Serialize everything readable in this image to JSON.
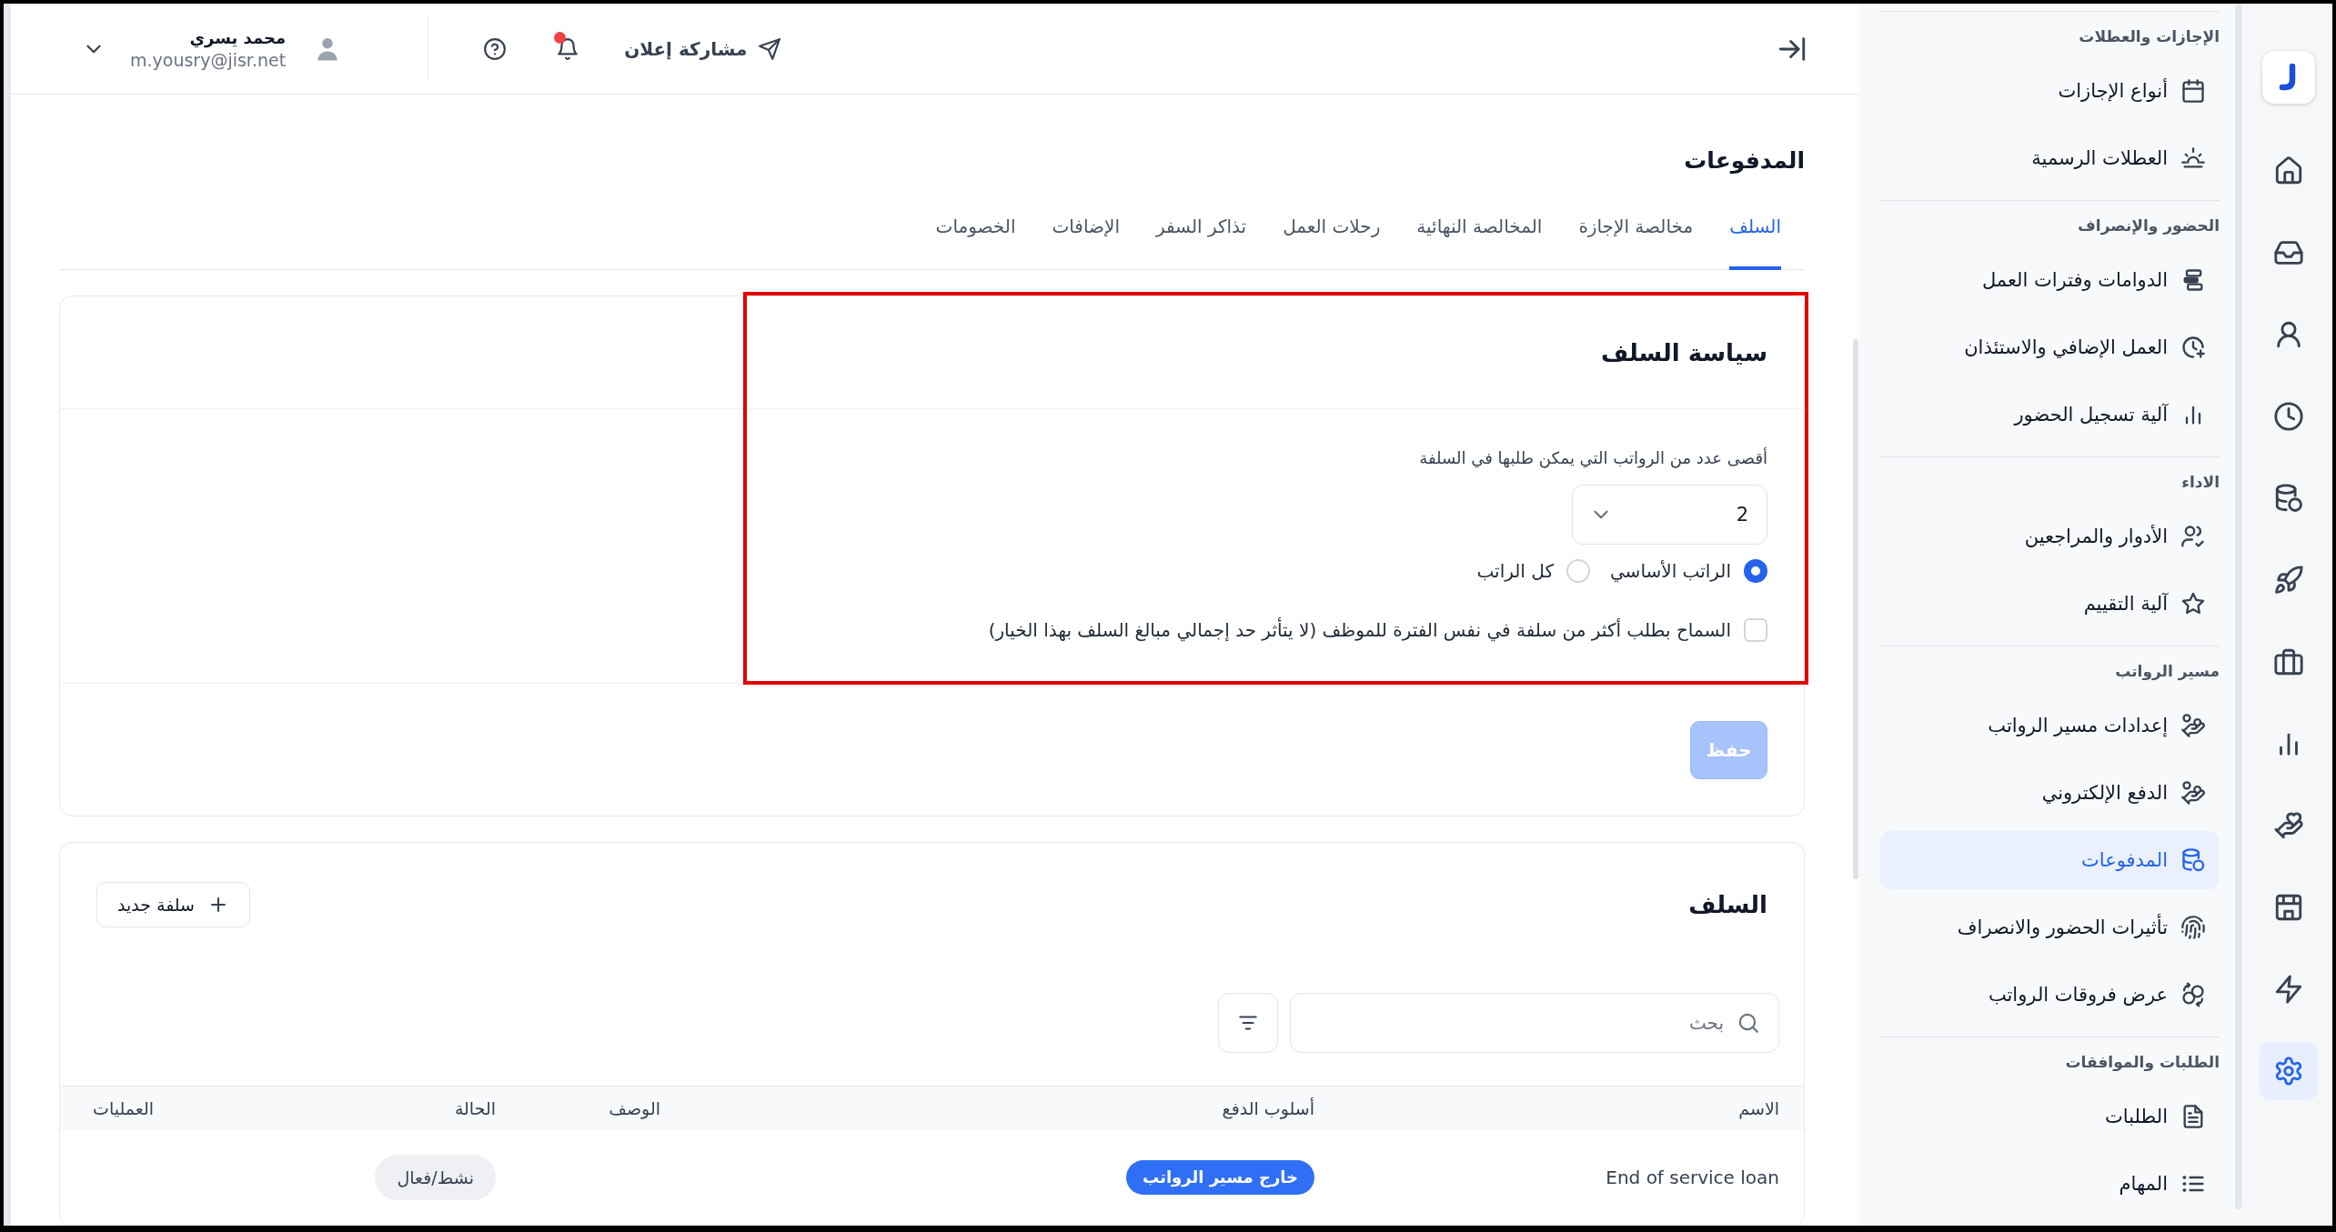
{
  "header": {
    "share_button": "مشاركة إعلان",
    "notifications": {
      "unread": true
    },
    "user": {
      "name": "محمد يسري",
      "email": "m.yousry@jisr.net"
    }
  },
  "page": {
    "title": "المدفوعات",
    "tabs": [
      {
        "label": "السلف",
        "selected": true
      },
      {
        "label": "مخالصة الإجازة",
        "selected": false
      },
      {
        "label": "المخالصة النهائية",
        "selected": false
      },
      {
        "label": "رحلات العمل",
        "selected": false
      },
      {
        "label": "تذاكر السفر",
        "selected": false
      },
      {
        "label": "الإضافات",
        "selected": false
      },
      {
        "label": "الخصومات",
        "selected": false
      }
    ]
  },
  "policy_card": {
    "highlighted": true,
    "title": "سياسة السلف",
    "max_salaries_field": {
      "label": "أقصى عدد من الرواتب التي يمكن طلبها في السلفة",
      "value": "2"
    },
    "salary_basis": [
      {
        "label": "الراتب الأساسي",
        "selected": true
      },
      {
        "label": "كل الراتب",
        "selected": false
      }
    ],
    "allow_multiple": {
      "label": "السماح بطلب أكثر من سلفة في نفس الفترة للموظف (لا يتأثر حد إجمالي مبالغ السلف بهذا الخيار)",
      "checked": false
    },
    "save_button": {
      "label": "حفظ",
      "disabled": true
    }
  },
  "advances_card": {
    "title": "السلف",
    "new_button": "سلفة جديد",
    "search": {
      "placeholder": "بحث"
    },
    "table": {
      "columns": [
        "الاسم",
        "أسلوب الدفع",
        "الوصف",
        "الحالة",
        "العمليات"
      ],
      "rows": [
        {
          "name": "End of service loan",
          "payment_method": "خارج مسير الرواتب",
          "status": "نشط/فعال"
        }
      ]
    }
  },
  "sidebar": {
    "sections": [
      {
        "title": "الإجازات والعطلات",
        "items": [
          {
            "label": "أنواع الإجازات",
            "selected": false
          },
          {
            "label": "العطلات الرسمية",
            "selected": false
          }
        ]
      },
      {
        "title": "الحضور والإنصراف",
        "items": [
          {
            "label": "الدوامات وفترات العمل",
            "selected": false
          },
          {
            "label": "العمل الإضافي والاستئذان",
            "selected": false
          },
          {
            "label": "آلية تسجيل الحضور",
            "selected": false
          }
        ]
      },
      {
        "title": "الاداء",
        "items": [
          {
            "label": "الأدوار والمراجعين",
            "selected": false
          },
          {
            "label": "آلية التقييم",
            "selected": false
          }
        ]
      },
      {
        "title": "مسير الرواتب",
        "items": [
          {
            "label": "إعدادات مسير الرواتب",
            "selected": false
          },
          {
            "label": "الدفع الإلكتروني",
            "selected": false
          },
          {
            "label": "المدفوعات",
            "selected": true
          },
          {
            "label": "تأثيرات الحضور والانصراف",
            "selected": false
          },
          {
            "label": "عرض فروقات الرواتب",
            "selected": false
          }
        ]
      },
      {
        "title": "الطلبات والموافقات",
        "items": [
          {
            "label": "الطلبات",
            "selected": false
          },
          {
            "label": "المهام",
            "selected": false
          }
        ]
      }
    ]
  },
  "rail": [
    {
      "selected": false
    },
    {
      "selected": false
    },
    {
      "selected": false
    },
    {
      "selected": false
    },
    {
      "selected": false
    },
    {
      "selected": false
    },
    {
      "selected": false
    },
    {
      "selected": false
    },
    {
      "selected": false
    },
    {
      "selected": false
    },
    {
      "selected": false
    },
    {
      "selected": true
    }
  ]
}
